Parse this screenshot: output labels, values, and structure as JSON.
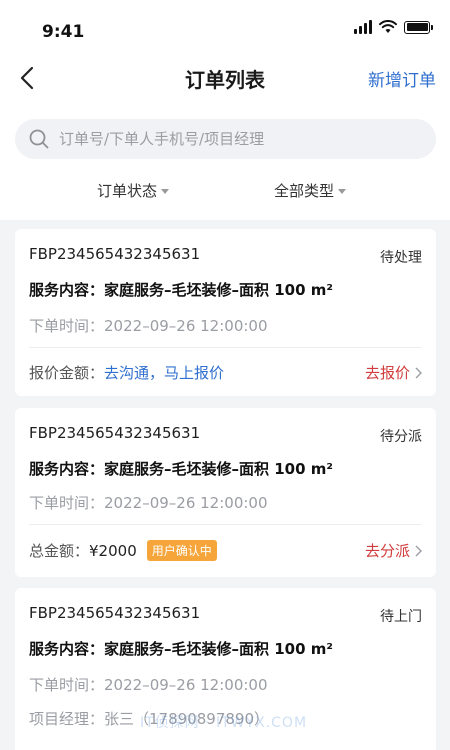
{
  "status_bar": {
    "time": "9:41"
  },
  "nav": {
    "title": "订单列表",
    "action": "新增订单"
  },
  "search": {
    "placeholder": "订单号/下单人手机号/项目经理"
  },
  "filters": [
    {
      "label": "订单状态"
    },
    {
      "label": "全部类型"
    }
  ],
  "orders": [
    {
      "order_no": "FBP234565432345631",
      "status": "待处理",
      "service": "服务内容：家庭服务–毛坯装修–面积 100 m²",
      "time_label": "下单时间：",
      "time_value": "2022–09–26 12:00:00",
      "footer_label": "报价金额：",
      "footer_value": "去沟通，马上报价",
      "action": "去报价"
    },
    {
      "order_no": "FBP234565432345631",
      "status": "待分派",
      "service": "服务内容：家庭服务–毛坯装修–面积 100 m²",
      "time_label": "下单时间：",
      "time_value": "2022–09–26 12:00:00",
      "footer_label": "总金额：",
      "footer_value": "¥2000",
      "badge": "用户确认中",
      "action": "去分派"
    },
    {
      "order_no": "FBP234565432345631",
      "status": "待上门",
      "service": "服务内容：家庭服务–毛坯装修–面积 100 m²",
      "time_label": "下单时间：",
      "time_value": "2022–09–26 12:00:00",
      "manager_label": "项目经理：",
      "manager_value": "张三（17890897890）"
    }
  ],
  "watermark": "IT侦探网 · ITWYX.COM",
  "colors": {
    "accent": "#2f6fcf",
    "action_red": "#d23c3c",
    "badge": "#f5a53a"
  }
}
